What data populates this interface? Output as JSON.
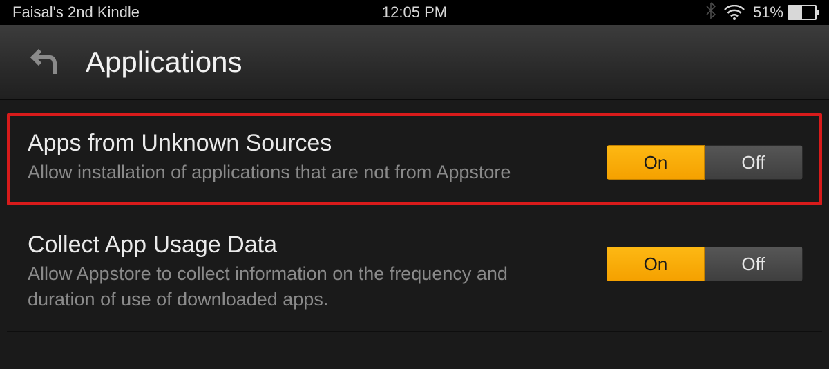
{
  "status_bar": {
    "device_name": "Faisal's 2nd Kindle",
    "time": "12:05 PM",
    "battery_percent": "51%",
    "battery_fill_pct": 51
  },
  "header": {
    "title": "Applications"
  },
  "settings": [
    {
      "title": "Apps from Unknown Sources",
      "desc": "Allow installation of applications that are not from Appstore",
      "on_label": "On",
      "off_label": "Off",
      "highlighted": true
    },
    {
      "title": "Collect App Usage Data",
      "desc": "Allow Appstore to collect information on the frequency and duration of use of downloaded apps.",
      "on_label": "On",
      "off_label": "Off",
      "highlighted": false
    }
  ]
}
